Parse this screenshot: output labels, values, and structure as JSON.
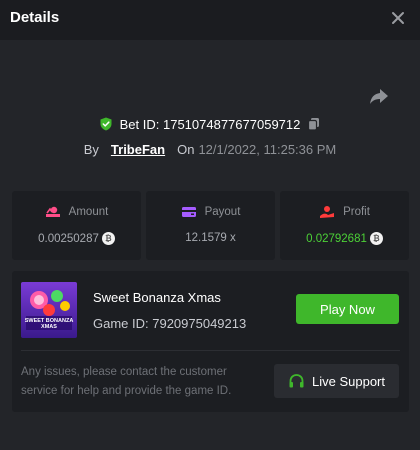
{
  "header": {
    "title": "Details",
    "close_icon": "close-icon"
  },
  "bet": {
    "id_label": "Bet ID: 1751074877677059712",
    "by_label": "By",
    "user": "TribeFan",
    "on_label": "On",
    "date": "12/1/2022, 11:25:36 PM",
    "icons": [
      "share-icon",
      "shield-check-icon",
      "copy-icon"
    ]
  },
  "stats": {
    "amount": {
      "label": "Amount",
      "value": "0.00250287",
      "icon": "amount-icon",
      "color": "#ff4d88"
    },
    "payout": {
      "label": "Payout",
      "value": "12.1579 x",
      "icon": "wallet-icon",
      "color": "#a55cff"
    },
    "profit": {
      "label": "Profit",
      "value": "0.02792681",
      "icon": "profit-icon",
      "color": "#ff3b3b",
      "value_color": "#4cd137"
    }
  },
  "game": {
    "name": "Sweet Bonanza Xmas",
    "id_label": "Game ID: 7920975049213",
    "thumb_text": "SWEET BONANZA\nXMAS",
    "play_label": "Play Now",
    "support_text": "Any issues, please contact the customer service for help and provide the game ID.",
    "support_label": "Live Support",
    "accent": "#3fb72b"
  }
}
